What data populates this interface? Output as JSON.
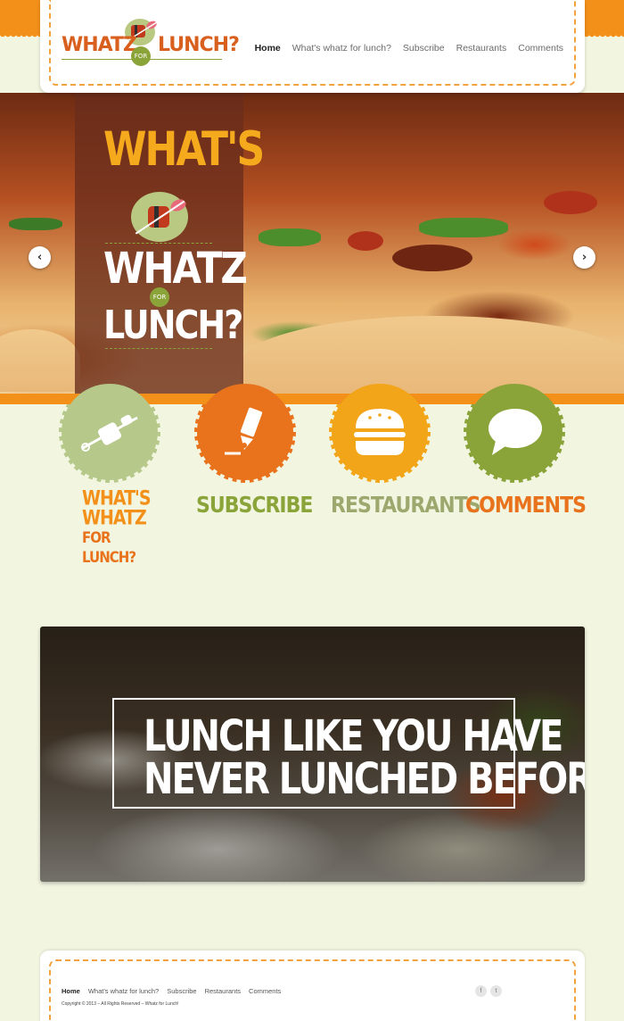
{
  "header": {
    "logo": {
      "word1": "WHATZ",
      "for": "FOR",
      "word2": "LUNCH?"
    },
    "nav": [
      {
        "label": "Home",
        "active": true
      },
      {
        "label": "What's whatz for lunch?"
      },
      {
        "label": "Subscribe"
      },
      {
        "label": "Restaurants"
      },
      {
        "label": "Comments"
      }
    ]
  },
  "hero": {
    "whats": "WHAT'S",
    "whatz": "WHATZ",
    "for": "FOR",
    "lunch": "LUNCH?",
    "prev_icon": "chevron-left-icon",
    "next_icon": "chevron-right-icon",
    "prev_glyph": "‹",
    "next_glyph": "›"
  },
  "features": [
    {
      "label_lines": [
        "WHAT'S",
        "WHATZ",
        "FOR LUNCH?"
      ],
      "icon": "skewer-icon",
      "color": "#b6c98a",
      "label_color": "#f39019"
    },
    {
      "label": "SUBSCRIBE",
      "icon": "pen-icon",
      "color": "#e8731c",
      "label_color": "#8ba43a"
    },
    {
      "label": "RESTAURANTS",
      "icon": "burger-icon",
      "color": "#f2a518",
      "label_color": "#9da86e"
    },
    {
      "label": "COMMENTS",
      "icon": "speech-bubble-icon",
      "color": "#8ba43a",
      "label_color": "#e8731c"
    }
  ],
  "banner": {
    "line1": "LUNCH LIKE YOU HAVE",
    "line2": "NEVER LUNCHED BEFORE!"
  },
  "footer": {
    "nav": [
      {
        "label": "Home",
        "active": true
      },
      {
        "label": "What's whatz for lunch?"
      },
      {
        "label": "Subscribe"
      },
      {
        "label": "Restaurants"
      },
      {
        "label": "Comments"
      }
    ],
    "copyright": "Copyright © 2013 – All Rights Reserved – Whatz for Lunch!",
    "social": [
      {
        "icon": "facebook-icon",
        "glyph": "f"
      },
      {
        "icon": "twitter-icon",
        "glyph": "t"
      }
    ]
  },
  "colors": {
    "orange": "#f39019",
    "green": "#8ba43a",
    "background": "#f2f6e1"
  }
}
